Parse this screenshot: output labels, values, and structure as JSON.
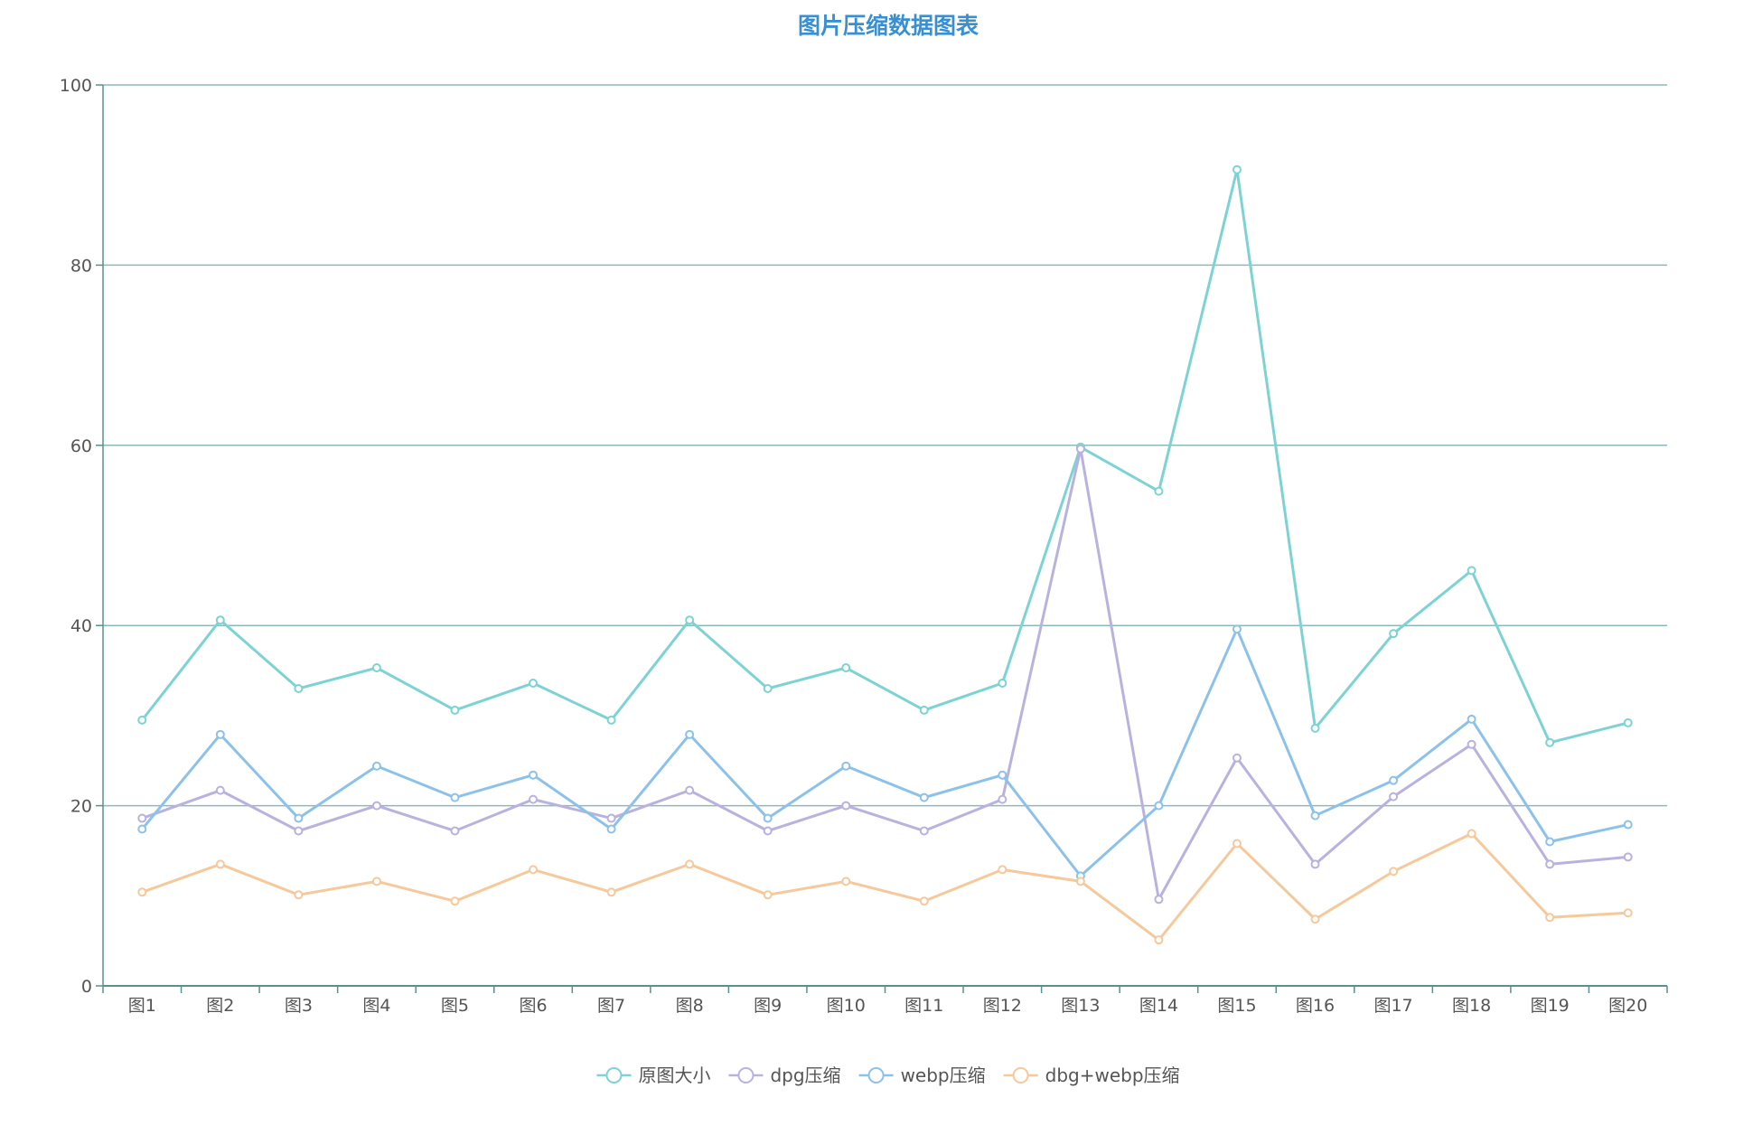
{
  "chart_data": {
    "type": "line",
    "title": "图片压缩数据图表",
    "categories": [
      "图1",
      "图2",
      "图3",
      "图4",
      "图5",
      "图6",
      "图7",
      "图8",
      "图9",
      "图10",
      "图11",
      "图12",
      "图13",
      "图14",
      "图15",
      "图16",
      "图17",
      "图18",
      "图19",
      "图20"
    ],
    "ylim": [
      0,
      100
    ],
    "yticks": [
      0,
      20,
      40,
      60,
      80,
      100
    ],
    "grid": true,
    "legend_position": "bottom-center",
    "series": [
      {
        "name": "原图大小",
        "color": "#7dd3d3",
        "values": [
          29.5,
          40.6,
          33.0,
          35.3,
          30.6,
          33.6,
          29.5,
          40.6,
          33.0,
          35.3,
          30.6,
          33.6,
          59.8,
          54.9,
          90.6,
          28.6,
          39.1,
          46.1,
          27.0,
          29.2
        ]
      },
      {
        "name": "dpg压缩",
        "color": "#b9b2de",
        "values": [
          18.6,
          21.7,
          17.2,
          20.0,
          17.2,
          20.7,
          18.6,
          21.7,
          17.2,
          20.0,
          17.2,
          20.7,
          59.6,
          9.6,
          25.3,
          13.5,
          21.0,
          26.8,
          13.5,
          14.3
        ]
      },
      {
        "name": "webp压缩",
        "color": "#8cc2ea",
        "values": [
          17.4,
          27.9,
          18.6,
          24.4,
          20.9,
          23.4,
          17.4,
          27.9,
          18.6,
          24.4,
          20.9,
          23.4,
          12.2,
          20.0,
          39.6,
          18.9,
          22.8,
          29.6,
          16.0,
          17.9
        ]
      },
      {
        "name": "dbg+webp压缩",
        "color": "#f5c99b",
        "values": [
          10.4,
          13.5,
          10.1,
          11.6,
          9.4,
          12.9,
          10.4,
          13.5,
          10.1,
          11.6,
          9.4,
          12.9,
          11.6,
          5.1,
          15.8,
          7.4,
          12.7,
          16.9,
          7.6,
          8.1
        ]
      }
    ]
  },
  "colors": {
    "title": "#3a8fd0",
    "grid": "#8fb8b8",
    "axis": "#5b8f8f",
    "tick_label": "#555555"
  }
}
